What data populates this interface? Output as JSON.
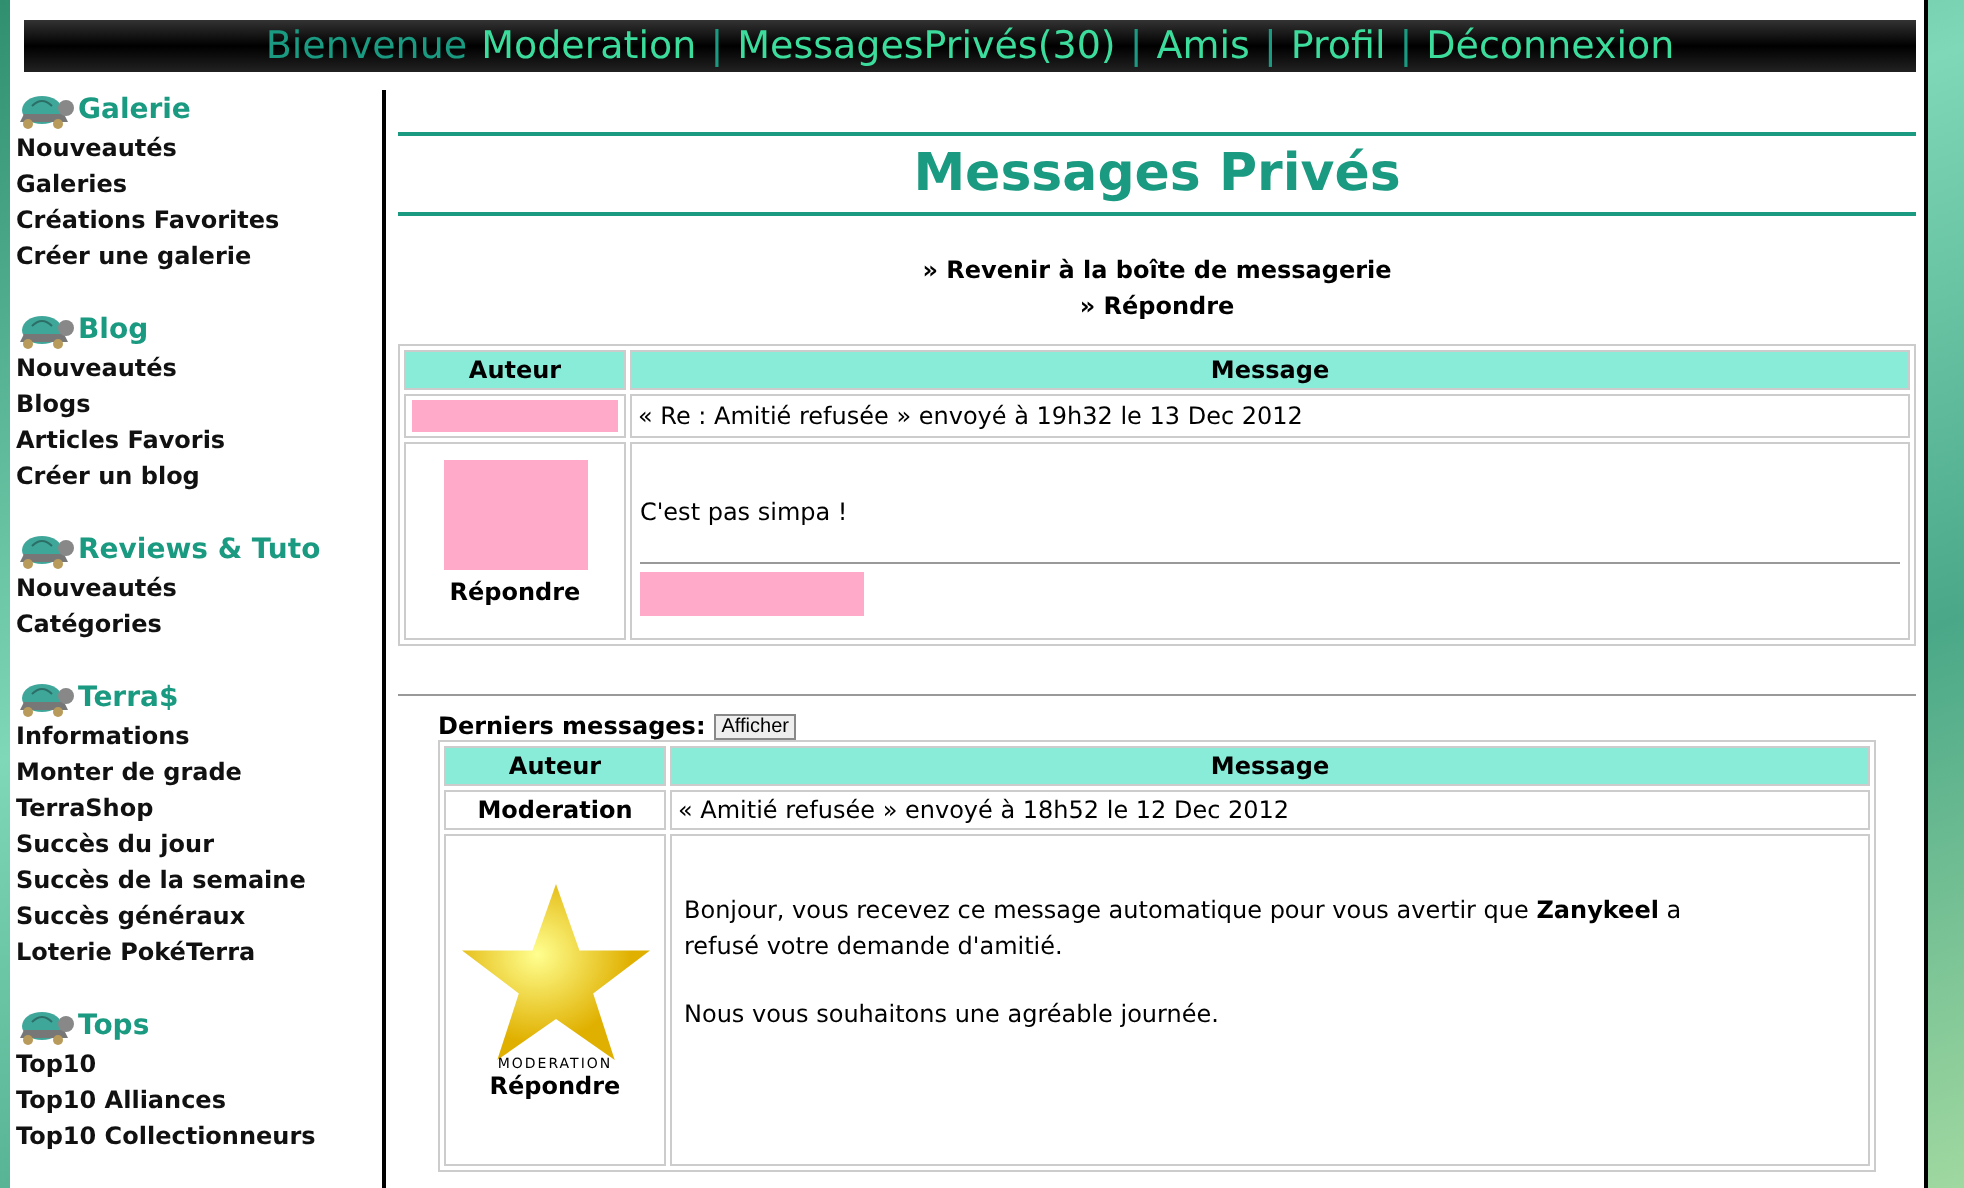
{
  "nav": [
    {
      "kind": "greeting",
      "text": "Bienvenue"
    },
    {
      "kind": "link",
      "text": "Moderation"
    },
    {
      "kind": "separator",
      "text": "|"
    },
    {
      "kind": "link",
      "text": "MessagesPrivés(30)"
    },
    {
      "kind": "separator",
      "text": "|"
    },
    {
      "kind": "link",
      "text": "Amis"
    },
    {
      "kind": "separator",
      "text": "|"
    },
    {
      "kind": "link",
      "text": "Profil"
    },
    {
      "kind": "separator",
      "text": "|"
    },
    {
      "kind": "link",
      "text": "Déconnexion"
    }
  ],
  "sidebar": [
    {
      "title": "Galerie",
      "items": [
        "Nouveautés",
        "Galeries",
        "Créations Favorites",
        "Créer une galerie"
      ]
    },
    {
      "title": "Blog",
      "items": [
        "Nouveautés",
        "Blogs",
        "Articles Favoris",
        "Créer un blog"
      ]
    },
    {
      "title": "Reviews & Tuto",
      "items": [
        "Nouveautés",
        "Catégories"
      ]
    },
    {
      "title": "Terra$",
      "items": [
        "Informations",
        "Monter de grade",
        "TerraShop",
        "Succès du jour",
        "Succès de la semaine",
        "Succès généraux",
        "Loterie PokéTerra"
      ]
    },
    {
      "title": "Tops",
      "items": [
        "Top10",
        "Top10 Alliances",
        "Top10 Collectionneurs"
      ]
    }
  ],
  "page_title": "Messages Privés",
  "actions": [
    "» Revenir à la boîte de messagerie",
    "» Répondre"
  ],
  "current_message": {
    "columns": [
      "Auteur",
      "Message"
    ],
    "author": {
      "redacted": true
    },
    "subject_line": "« Re : Amitié refusée » envoyé à 19h32 le 13 Dec 2012",
    "avatar": {
      "kind": "redacted"
    },
    "reply_link": "Répondre",
    "body": [
      "C'est pas simpa !"
    ],
    "signature": {
      "redacted": true
    }
  },
  "history": {
    "label": "Derniers messages:",
    "button": "Afficher",
    "columns": [
      "Auteur",
      "Message"
    ],
    "messages": [
      {
        "author": {
          "name": "Moderation"
        },
        "subject_line": "« Amitié refusée » envoyé à 18h52 le 12 Dec 2012",
        "avatar": {
          "kind": "star",
          "caption": "MODERATION"
        },
        "reply_link": "Répondre",
        "body": [
          "Bonjour, vous recevez ce message automatique pour vous avertir que **Zanykeel** a refusé votre demande d'amitié.",
          "Nous vous souhaitons une agréable journée."
        ]
      }
    ]
  }
}
